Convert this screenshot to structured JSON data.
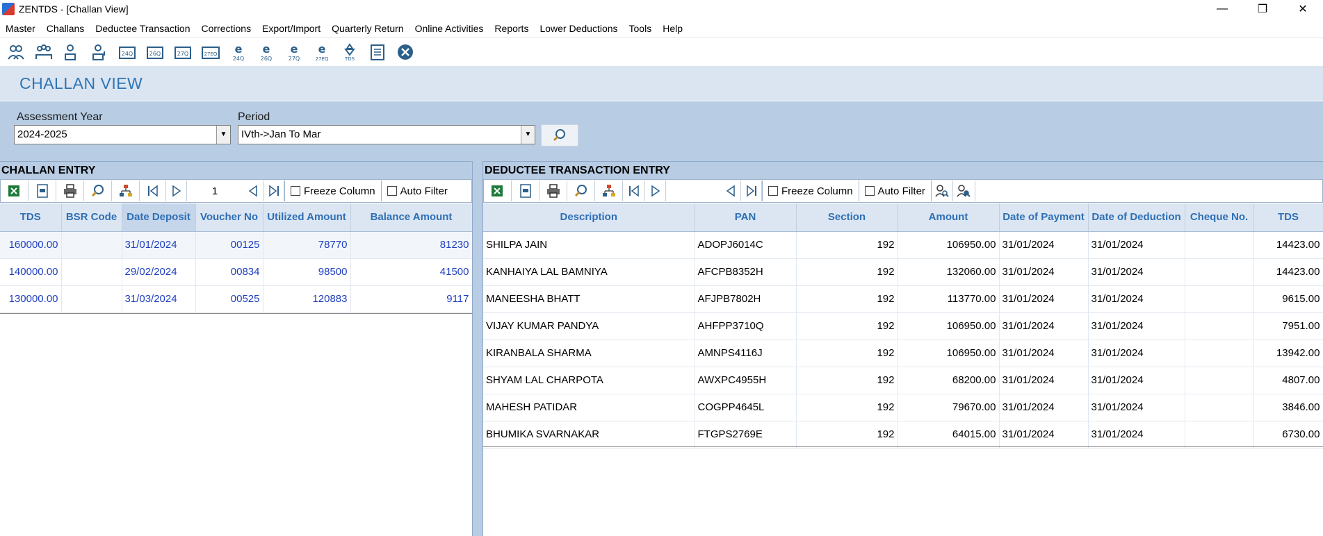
{
  "window": {
    "title": "ZENTDS - [Challan View]",
    "minimize": "—",
    "restore": "❐",
    "close": "✕"
  },
  "menu": [
    "Master",
    "Challans",
    "Deductee Transaction",
    "Corrections",
    "Export/Import",
    "Quarterly Return",
    "Online Activities",
    "Reports",
    "Lower Deductions",
    "Tools",
    "Help"
  ],
  "toolbar_icons": [
    "deductor-icon",
    "employees-icon",
    "deductee-icon",
    "deductee-alt-icon",
    "form-24q-icon",
    "form-26q-icon",
    "form-27q-icon",
    "form-27eq-icon",
    "e-24q-icon",
    "e-26q-icon",
    "e-27q-icon",
    "e-27eq-icon",
    "tds-icon",
    "notepad-icon",
    "exit-icon"
  ],
  "toolbar_labels": {
    "form_24q": "24Q",
    "form_26q": "26Q",
    "form_27q": "27Q",
    "form_27eq": "27EQ",
    "e24": "24Q",
    "e26": "26Q",
    "e27": "27Q",
    "e27eq": "27EQ",
    "tds": "TDS",
    "e": "e"
  },
  "header": {
    "title": "CHALLAN VIEW"
  },
  "filters": {
    "assessment_year_label": "Assessment Year",
    "assessment_year_value": "2024-2025",
    "period_label": "Period",
    "period_value": "IVth->Jan To Mar"
  },
  "challan": {
    "panel_title": "CHALLAN ENTRY",
    "page_number": "1",
    "freeze_label": "Freeze Column",
    "autofilter_label": "Auto Filter",
    "columns": [
      "TDS",
      "BSR Code",
      "Date Deposit",
      "Voucher No",
      "Utilized Amount",
      "Balance Amount"
    ],
    "rows": [
      [
        "160000.00",
        "",
        "31/01/2024",
        "00125",
        "78770",
        "81230"
      ],
      [
        "140000.00",
        "",
        "29/02/2024",
        "00834",
        "98500",
        "41500"
      ],
      [
        "130000.00",
        "",
        "31/03/2024",
        "00525",
        "120883",
        "9117"
      ]
    ]
  },
  "deductee": {
    "panel_title": "DEDUCTEE TRANSACTION ENTRY",
    "freeze_label": "Freeze Column",
    "autofilter_label": "Auto Filter",
    "columns": [
      "Description",
      "PAN",
      "Section",
      "Amount",
      "Date of Payment",
      "Date of Deduction",
      "Cheque No.",
      "TDS"
    ],
    "rows": [
      [
        "SHILPA JAIN",
        "ADOPJ6014C",
        "192",
        "106950.00",
        "31/01/2024",
        "31/01/2024",
        "",
        "14423.00"
      ],
      [
        "KANHAIYA LAL BAMNIYA",
        "AFCPB8352H",
        "192",
        "132060.00",
        "31/01/2024",
        "31/01/2024",
        "",
        "14423.00"
      ],
      [
        "MANEESHA BHATT",
        "AFJPB7802H",
        "192",
        "113770.00",
        "31/01/2024",
        "31/01/2024",
        "",
        "9615.00"
      ],
      [
        "VIJAY KUMAR PANDYA",
        "AHFPP3710Q",
        "192",
        "106950.00",
        "31/01/2024",
        "31/01/2024",
        "",
        "7951.00"
      ],
      [
        "KIRANBALA SHARMA",
        "AMNPS4116J",
        "192",
        "106950.00",
        "31/01/2024",
        "31/01/2024",
        "",
        "13942.00"
      ],
      [
        "SHYAM LAL CHARPOTA",
        "AWXPC4955H",
        "192",
        "68200.00",
        "31/01/2024",
        "31/01/2024",
        "",
        "4807.00"
      ],
      [
        "MAHESH PATIDAR",
        "COGPP4645L",
        "192",
        "79670.00",
        "31/01/2024",
        "31/01/2024",
        "",
        "3846.00"
      ],
      [
        "BHUMIKA SVARNAKAR",
        "FTGPS2769E",
        "192",
        "64015.00",
        "31/01/2024",
        "31/01/2024",
        "",
        "6730.00"
      ]
    ]
  }
}
